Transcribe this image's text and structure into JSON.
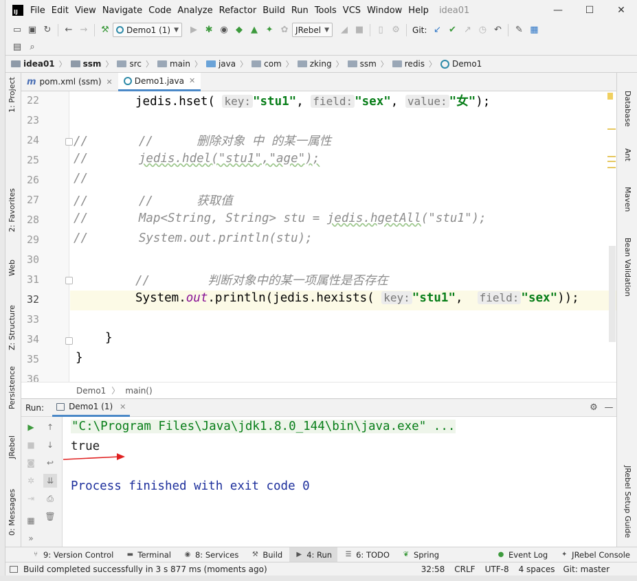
{
  "window": {
    "menu": [
      "File",
      "Edit",
      "View",
      "Navigate",
      "Code",
      "Analyze",
      "Refactor",
      "Build",
      "Run",
      "Tools",
      "VCS",
      "Window",
      "Help"
    ],
    "project_name": "idea01",
    "app_logo_text": "IJ",
    "controls": {
      "minimize": "—",
      "maximize": "☐",
      "close": "✕"
    }
  },
  "toolbar": {
    "run_config": "Demo1 (1)",
    "jrebel": "JRebel",
    "git_label": "Git:"
  },
  "breadcrumb": [
    "idea01",
    "ssm",
    "src",
    "main",
    "java",
    "com",
    "zking",
    "ssm",
    "redis",
    "Demo1"
  ],
  "left_tool_tabs": [
    "1: Project",
    "2: Favorites",
    "Web",
    "Z: Structure",
    "Persistence",
    "JRebel",
    "0: Messages"
  ],
  "right_tool_tabs": [
    "Database",
    "Ant",
    "Maven",
    "Bean Validation",
    "JRebel Setup Guide"
  ],
  "editor_tabs": [
    {
      "label": "pom.xml (ssm)",
      "icon": "maven-icon",
      "active": false
    },
    {
      "label": "Demo1.java",
      "icon": "class-icon",
      "active": true
    }
  ],
  "editor": {
    "line_numbers": [
      "22",
      "23",
      "24",
      "25",
      "26",
      "27",
      "28",
      "29",
      "30",
      "31",
      "32",
      "33",
      "34",
      "35",
      "36"
    ],
    "current_line": "32",
    "lines": {
      "l22": {
        "pre": "jedis.hset(",
        "h1": "key:",
        "s1": "\"stu1\"",
        "c1": ",",
        "h2": "field:",
        "s2": "\"sex\"",
        "c2": ",",
        "h3": "value:",
        "s3": "\"女\"",
        "end": ");"
      },
      "l24": {
        "a": "//",
        "b": "//      删除对象 中 的某一属性"
      },
      "l25": {
        "a": "//",
        "b": "jedis.hdel(\"stu1\",\"age\");"
      },
      "l26": {
        "a": "//"
      },
      "l27": {
        "a": "//",
        "b": "//      获取值"
      },
      "l28": {
        "a": "//",
        "b": "Map<String, String> stu = ",
        "u": "jedis.hgetAll",
        "c": "(\"stu1\");"
      },
      "l29": {
        "a": "//",
        "b": "System.out.println(stu);"
      },
      "l31": {
        "b": "//        判断对象中的某一项属性是否存在"
      },
      "l32": {
        "p1": "System.",
        "fld": "out",
        "p2": ".println(jedis.hexists(",
        "h1": "key:",
        "s1": "\"stu1\"",
        "c1": ",",
        "h2": "field:",
        "s2": "\"sex\"",
        "end": "));"
      },
      "l34": {
        "t": "}"
      },
      "l35": {
        "t": "}"
      }
    },
    "crumbs": [
      "Demo1",
      "main()"
    ]
  },
  "run_panel": {
    "label": "Run:",
    "tab": "Demo1 (1)",
    "console": {
      "command": "\"C:\\Program Files\\Java\\jdk1.8.0_144\\bin\\java.exe\" ...",
      "output": "true",
      "exit": "Process finished with exit code 0"
    },
    "annotation_color": "#e02020"
  },
  "bottom_tabs": [
    {
      "label": "9: Version Control",
      "icon": "branch-icon"
    },
    {
      "label": "Terminal",
      "icon": "terminal-icon"
    },
    {
      "label": "8: Services",
      "icon": "services-icon"
    },
    {
      "label": "Build",
      "icon": "hammer-icon"
    },
    {
      "label": "4: Run",
      "icon": "run-icon",
      "active": true
    },
    {
      "label": "6: TODO",
      "icon": "todo-icon"
    },
    {
      "label": "Spring",
      "icon": "spring-icon"
    },
    {
      "label": "Event Log",
      "icon": "event-log-icon"
    },
    {
      "label": "JRebel Console",
      "icon": "jrebel-icon"
    }
  ],
  "status": {
    "message": "Build completed successfully in 3 s 877 ms (moments ago)",
    "position": "32:58",
    "line_sep": "CRLF",
    "encoding": "UTF-8",
    "indent": "4 spaces",
    "git": "Git: master"
  }
}
